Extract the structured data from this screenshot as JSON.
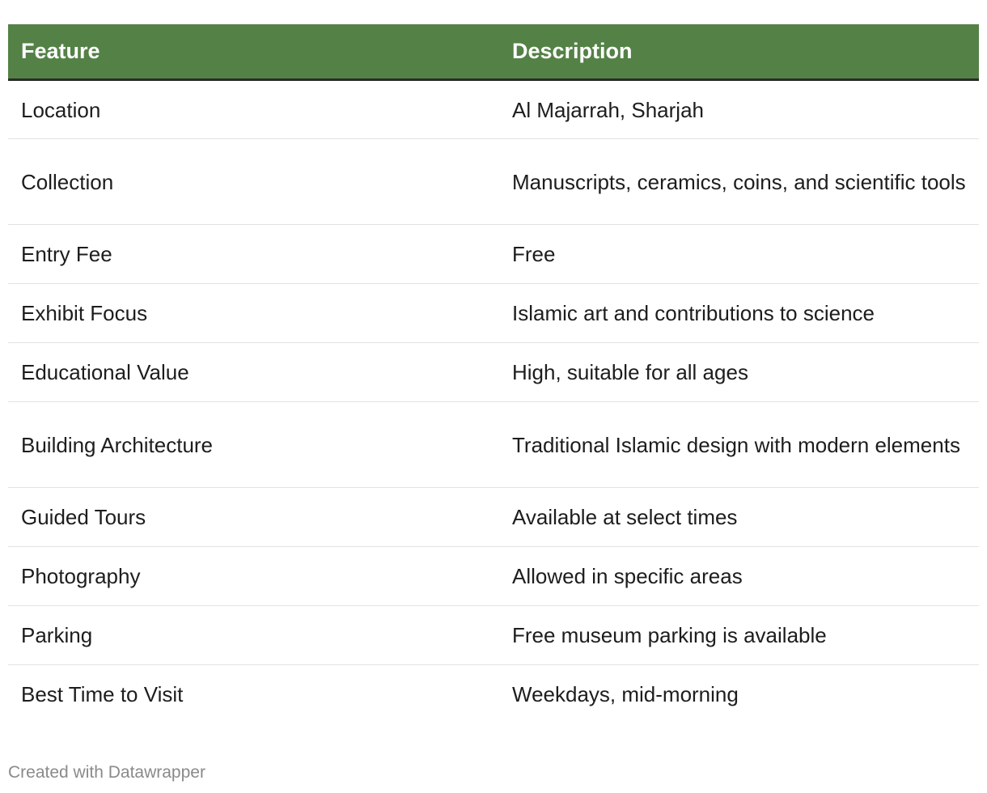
{
  "table": {
    "header": {
      "feature": "Feature",
      "description": "Description"
    },
    "rows": [
      {
        "feature": "Location",
        "description": "Al Majarrah, Sharjah"
      },
      {
        "feature": "Collection",
        "description": "Manuscripts, ceramics, coins, and scientific tools"
      },
      {
        "feature": "Entry Fee",
        "description": "Free"
      },
      {
        "feature": "Exhibit Focus",
        "description": "Islamic art and contributions to science"
      },
      {
        "feature": "Educational Value",
        "description": "High, suitable for all ages"
      },
      {
        "feature": "Building Architecture",
        "description": "Traditional Islamic design with modern elements"
      },
      {
        "feature": "Guided Tours",
        "description": "Available at select times"
      },
      {
        "feature": "Photography",
        "description": "Allowed in specific areas"
      },
      {
        "feature": "Parking",
        "description": "Free museum parking is available"
      },
      {
        "feature": "Best Time to Visit",
        "description": "Weekdays, mid-morning"
      }
    ]
  },
  "footer": {
    "credit": "Created with Datawrapper"
  },
  "colors": {
    "header_background": "#548146",
    "header_text": "#ffffff"
  }
}
